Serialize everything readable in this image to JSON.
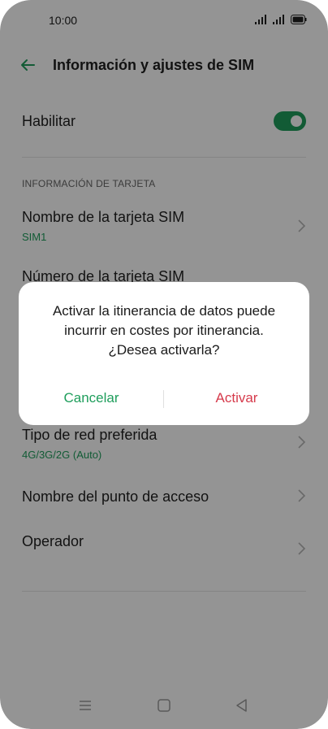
{
  "status_bar": {
    "time": "10:00"
  },
  "app_bar": {
    "title": "Información y ajustes de SIM"
  },
  "settings": {
    "enable_label": "Habilitar",
    "enable_on": true,
    "section_header": "INFORMACIÓN DE TARJETA",
    "sim_name_label": "Nombre de la tarjeta SIM",
    "sim_name_value": "SIM1",
    "sim_number_label": "Número de la tarjeta SIM",
    "network_type_label": "Tipo de red preferida",
    "network_type_value": "4G/3G/2G (Auto)",
    "apn_label": "Nombre del punto de acceso",
    "operator_label": "Operador"
  },
  "dialog": {
    "message": "Activar la itinerancia de datos puede incurrir en costes por itinerancia. ¿Desea activarla?",
    "cancel_label": "Cancelar",
    "confirm_label": "Activar"
  },
  "colors": {
    "accent": "#1f9e5c",
    "danger": "#d63a4b",
    "scrim": "rgba(0,0,0,0.42)"
  },
  "icons": {
    "back": "arrow-left-icon",
    "chevron": "chevron-right-icon",
    "signal": "signal-icon",
    "battery": "battery-icon",
    "nav_menu": "menu-icon",
    "nav_home": "home-square-icon",
    "nav_back": "back-triangle-icon"
  }
}
